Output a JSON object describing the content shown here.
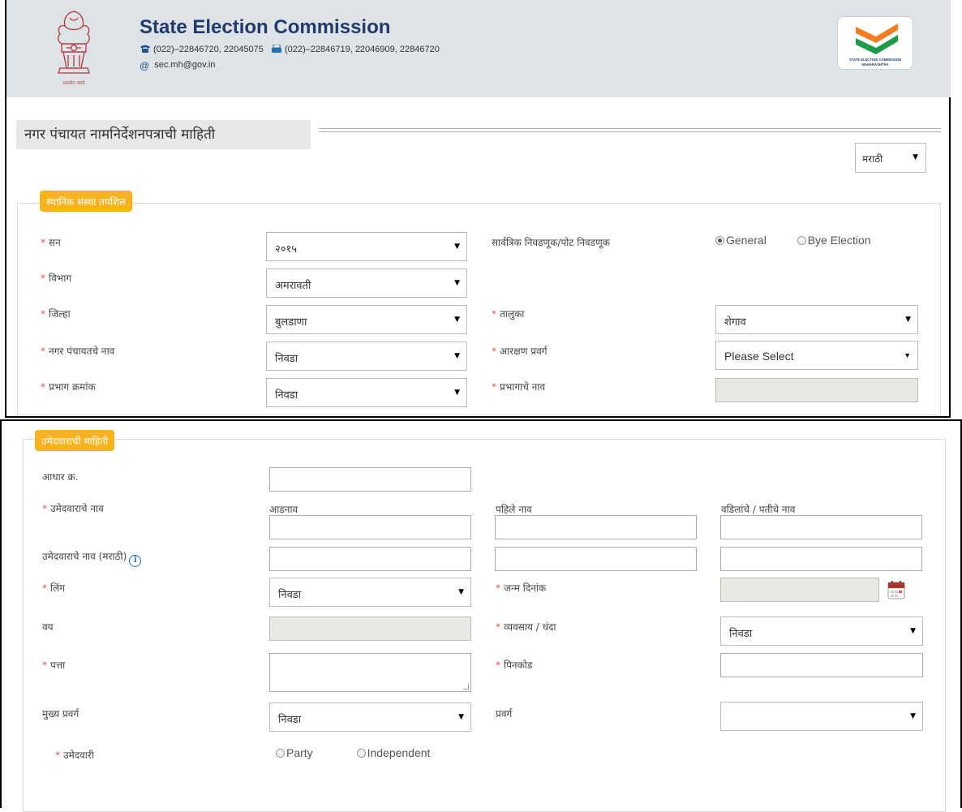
{
  "header": {
    "title": "State Election Commission",
    "phone": "(022)–22846720, 22045075",
    "fax": "(022)–22846719, 22046909, 22846720",
    "email": "sec.mh@gov.in",
    "emblem_motto": "सत्यमेव जयते",
    "logo_text_line1": "STATE ELECTION COMMISSION",
    "logo_text_line2": "MAHARASHTRA"
  },
  "page_title": "नगर पंचायत नामनिर्देशनपत्राची माहिती",
  "language_select": {
    "value": "मराठी"
  },
  "local_body": {
    "legend": "स्थानिक संस्था तपशिल",
    "year": {
      "label": "सन",
      "value": "२०१५"
    },
    "election_type": {
      "label": "सार्वत्रिक निवडणूक/पोट निवडणूक",
      "options": [
        "General",
        "Bye Election"
      ],
      "selected": "General"
    },
    "division": {
      "label": "विभाग",
      "value": "अमरावती"
    },
    "district": {
      "label": "जिल्हा",
      "value": "बुलडाणा"
    },
    "taluka": {
      "label": "तालुका",
      "value": "शेगाव"
    },
    "np_name": {
      "label": "नगर पंचायतचे नाव",
      "value": "निवडा"
    },
    "reservation": {
      "label": "आरक्षण प्रवर्ग",
      "value": "Please Select"
    },
    "ward_no": {
      "label": "प्रभाग क्रमांक",
      "value": "निवडा"
    },
    "ward_name": {
      "label": "प्रभागाचे नाव",
      "value": ""
    }
  },
  "candidate": {
    "legend": "उमेदवाराची माहिती",
    "aadhar": {
      "label": "आधार क्र.",
      "value": ""
    },
    "name": {
      "label": "उमेदवाराचे नाव",
      "surname": "आडनाव",
      "first_name": "पहिले नाव",
      "father_name": "वडिलांचे / पतीचे नाव"
    },
    "name_marathi": {
      "label": "उमेदवाराचे नाव (मराठी)",
      "info_icon": "info-icon"
    },
    "gender": {
      "label": "लिंग",
      "value": "निवडा"
    },
    "dob": {
      "label": "जन्म दिनांक",
      "value": ""
    },
    "age": {
      "label": "वय",
      "value": ""
    },
    "occupation": {
      "label": "व्यवसाय / धंदा",
      "value": "निवडा"
    },
    "address": {
      "label": "पत्ता",
      "value": ""
    },
    "pincode": {
      "label": "पिनकोड",
      "value": ""
    },
    "main_category": {
      "label": "मुख्य प्रवर्ग",
      "value": "निवडा"
    },
    "category": {
      "label": "प्रवर्ग",
      "value": ""
    },
    "candidature": {
      "label": "उमेदवारी",
      "options": [
        "Party",
        "Independent"
      ],
      "selected": ""
    }
  },
  "colors": {
    "legend_bg": "#f7b21c",
    "required": "#d9534f",
    "title": "#1f3a6b",
    "header_bg": "#dde3e6"
  }
}
